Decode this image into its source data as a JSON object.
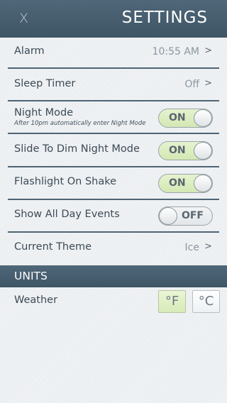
{
  "header": {
    "close_label": "X",
    "title": "SETTINGS"
  },
  "rows": [
    {
      "label": "Alarm",
      "value": "10:55 AM",
      "chevron": ">"
    },
    {
      "label": "Sleep Timer",
      "value": "Off",
      "chevron": ">"
    },
    {
      "label": "Night Mode",
      "subtitle": "After 10pm automatically enter Night Mode",
      "toggle": "ON"
    },
    {
      "label": "Slide To Dim Night Mode",
      "toggle": "ON"
    },
    {
      "label": "Flashlight On Shake",
      "toggle": "ON"
    },
    {
      "label": "Show All Day Events",
      "toggle": "OFF"
    },
    {
      "label": "Current Theme",
      "value": "Ice",
      "chevron": ">"
    }
  ],
  "units": {
    "section_title": "UNITS",
    "weather_label": "Weather",
    "fahrenheit": "°F",
    "celsius": "°C",
    "selected": "°F"
  },
  "colors": {
    "header": "#466070",
    "toggle_on": "#d9ecbc",
    "divider": "#4f6474"
  }
}
